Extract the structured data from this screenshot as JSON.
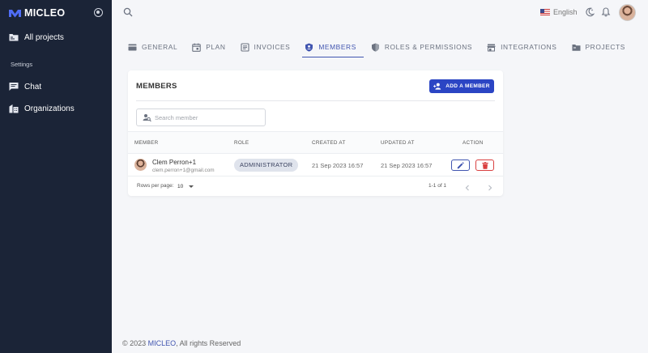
{
  "sidebar": {
    "brand": "MICLEO",
    "items": [
      {
        "label": "All projects"
      },
      {
        "label": "Chat"
      },
      {
        "label": "Organizations"
      }
    ],
    "section_label": "Settings"
  },
  "topbar": {
    "language": "English"
  },
  "tabs": [
    {
      "label": "General"
    },
    {
      "label": "Plan"
    },
    {
      "label": "Invoices"
    },
    {
      "label": "Members"
    },
    {
      "label": "Roles & Permissions"
    },
    {
      "label": "Integrations"
    },
    {
      "label": "Projects"
    }
  ],
  "active_tab": "Members",
  "members_card": {
    "title": "MEMBERS",
    "add_button": "ADD A MEMBER",
    "search_placeholder": "Search member",
    "columns": [
      "Member",
      "Role",
      "Created at",
      "Updated at",
      "Action"
    ],
    "rows": [
      {
        "name": "Clem Perron+1",
        "email": "clem.perron+1@gmail.com",
        "role": "ADMINISTRATOR",
        "created_at": "21 Sep 2023 16:57",
        "updated_at": "21 Sep 2023 16:57"
      }
    ],
    "pagination": {
      "rows_per_page_label": "Rows per page:",
      "rows_per_page": "10",
      "range": "1-1 of 1"
    }
  },
  "footer": {
    "prefix": "© 2023 ",
    "brand": "MICLEO",
    "suffix": ", All rights Reserved"
  },
  "colors": {
    "sidebar_bg": "#1b2437",
    "accent": "#2b45c4",
    "tab_active": "#4155b0",
    "delete": "#d94040",
    "page_bg": "#f5f6f9"
  }
}
